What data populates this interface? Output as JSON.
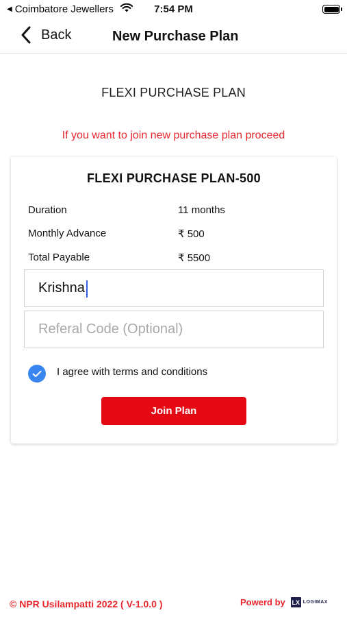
{
  "status_bar": {
    "back_app": "Coimbatore Jewellers",
    "time": "7:54 PM"
  },
  "nav": {
    "back_label": "Back",
    "title": "New Purchase Plan"
  },
  "section_title": "FLEXI PURCHASE PLAN",
  "notice": "If you want to join new purchase plan proceed",
  "plan": {
    "title": "FLEXI PURCHASE PLAN-500",
    "rows": [
      {
        "label": "Duration",
        "value": "11 months"
      },
      {
        "label": "Monthly Advance",
        "value": "₹ 500"
      },
      {
        "label": "Total Payable",
        "value": "₹ 5500"
      }
    ],
    "name_value": "Krishna",
    "referral_placeholder": "Referal Code (Optional)",
    "agree_label": "I agree with terms and conditions",
    "agree_checked": true,
    "join_label": "Join Plan"
  },
  "footer": {
    "copyright": "© NPR Usilampatti 2022 ( V-1.0.0 )",
    "powered_by": "Powerd by",
    "logo_mark": "LX",
    "logo_text": "LOGIMAX"
  },
  "colors": {
    "accent_red": "#e50914",
    "notice_red": "#e8262d",
    "checkbox_blue": "#3a86f0"
  }
}
